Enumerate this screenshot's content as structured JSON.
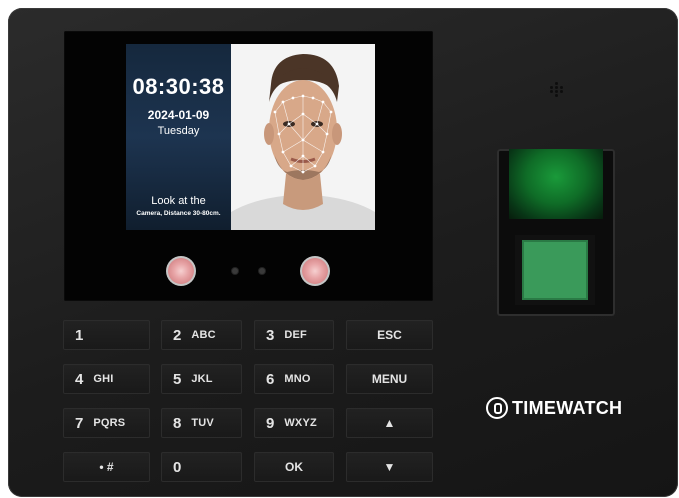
{
  "screen": {
    "time": "08:30:38",
    "date": "2024-01-09",
    "day": "Tuesday",
    "prompt_line1": "Look at the",
    "prompt_line2": "Camera, Distance 30-80cm."
  },
  "keypad": {
    "k1": {
      "num": "1",
      "sub": ""
    },
    "k2": {
      "num": "2",
      "sub": "ABC"
    },
    "k3": {
      "num": "3",
      "sub": "DEF"
    },
    "esc": "ESC",
    "k4": {
      "num": "4",
      "sub": "GHI"
    },
    "k5": {
      "num": "5",
      "sub": "JKL"
    },
    "k6": {
      "num": "6",
      "sub": "MNO"
    },
    "menu": "MENU",
    "k7": {
      "num": "7",
      "sub": "PQRS"
    },
    "k8": {
      "num": "8",
      "sub": "TUV"
    },
    "k9": {
      "num": "9",
      "sub": "WXYZ"
    },
    "up": "▲",
    "dot_hash": "•  #",
    "k0": {
      "num": "0",
      "sub": ""
    },
    "ok": "OK",
    "down": "▼"
  },
  "brand": {
    "name": "TIMEWATCH"
  },
  "colors": {
    "fingerprint_glow": "#1a9a3a",
    "screen_bg": "#15283d",
    "ir_led": "#e7a4a6"
  },
  "icons": {
    "brand_logo": "timewatch-logo-icon",
    "speaker": "speaker-grille-icon"
  }
}
